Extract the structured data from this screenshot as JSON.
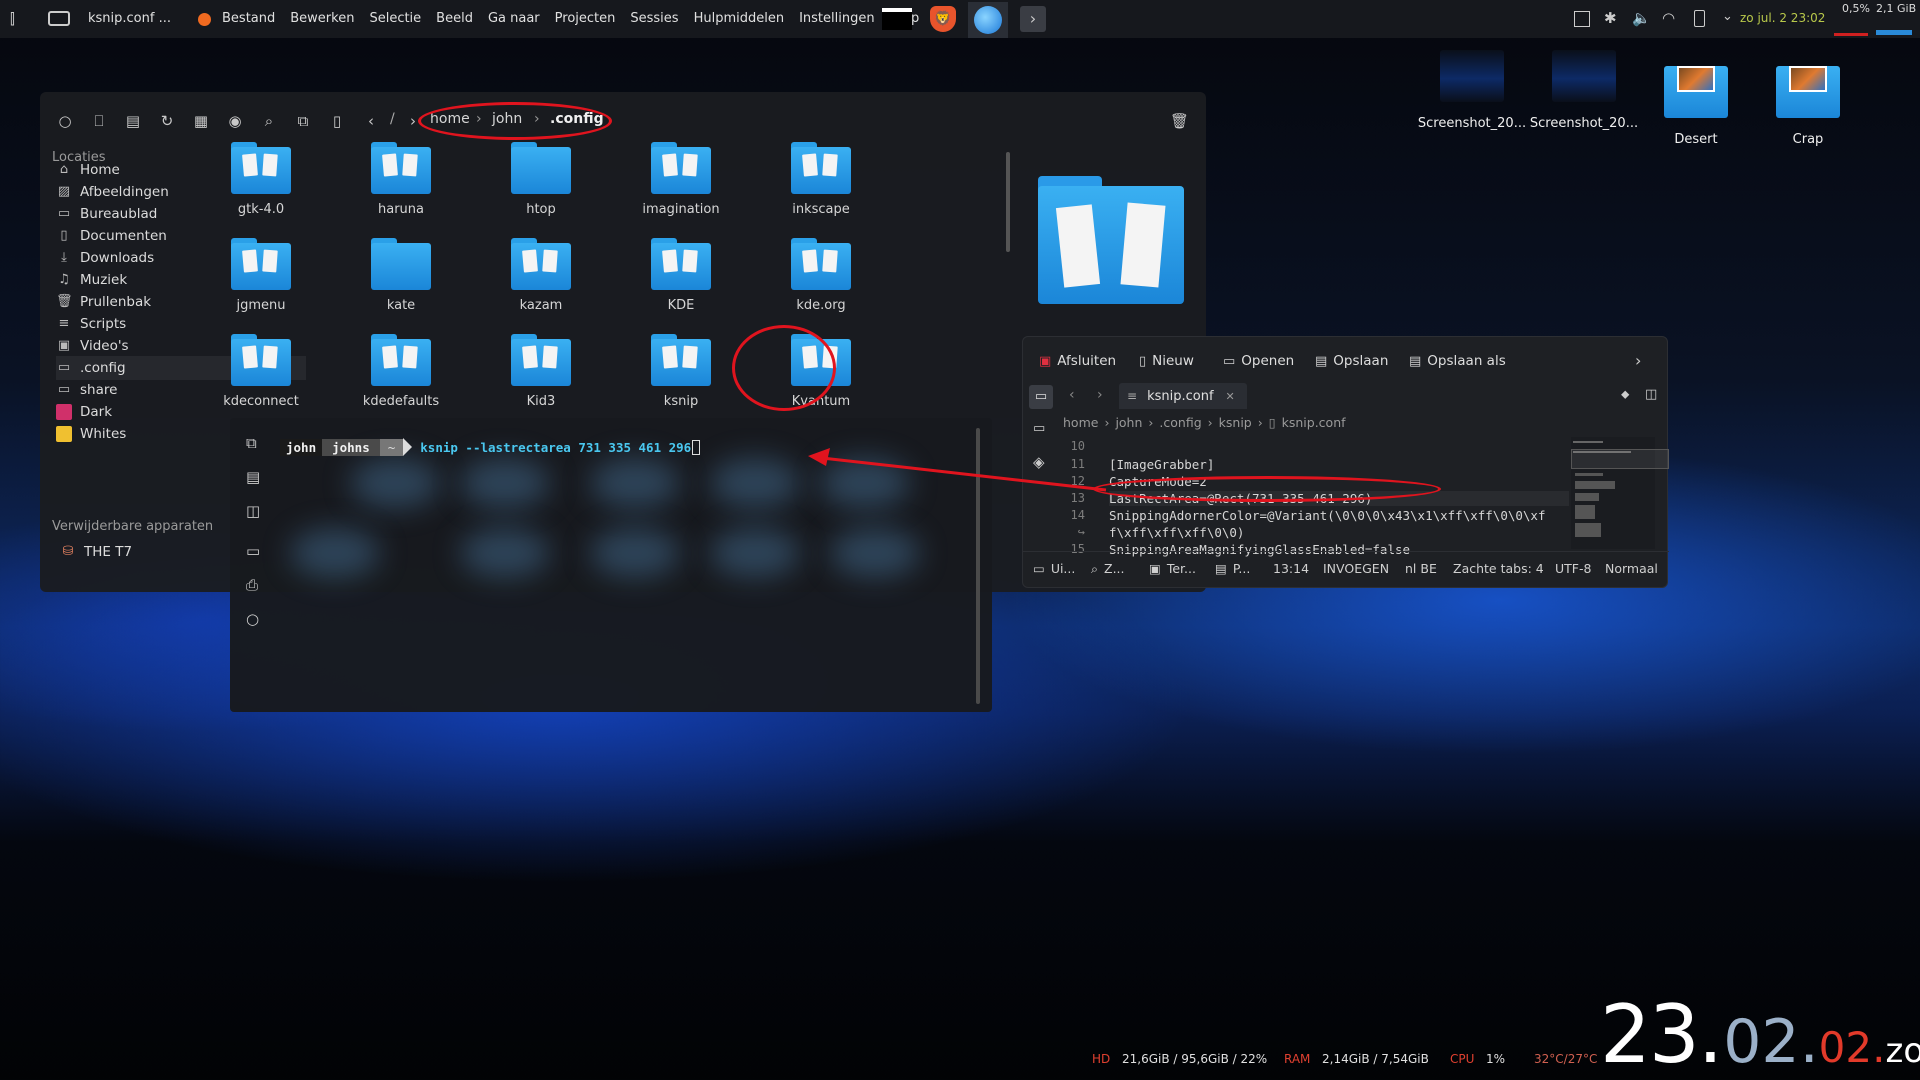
{
  "panel": {
    "window_title": "ksnip.conf ...",
    "menu": [
      "Bestand",
      "Bewerken",
      "Selectie",
      "Beeld",
      "Ga naar",
      "Projecten",
      "Sessies",
      "Hulpmiddelen",
      "Instellingen",
      "Help"
    ],
    "tray_date": "zo jul. 2 23:02",
    "cpu_percent": "0,5%",
    "mem_used": "2,1 GiB"
  },
  "file_manager": {
    "breadcrumb": [
      "home",
      "john",
      ".config"
    ],
    "breadcrumb_root": "/",
    "places_heading": "Locaties",
    "places": [
      {
        "label": "Home",
        "icon": "home-icon"
      },
      {
        "label": "Afbeeldingen",
        "icon": "image-icon"
      },
      {
        "label": "Bureaublad",
        "icon": "desktop-icon"
      },
      {
        "label": "Documenten",
        "icon": "document-icon"
      },
      {
        "label": "Downloads",
        "icon": "download-icon"
      },
      {
        "label": "Muziek",
        "icon": "music-icon"
      },
      {
        "label": "Prullenbak",
        "icon": "trash-icon"
      },
      {
        "label": "Scripts",
        "icon": "list-icon"
      },
      {
        "label": "Video's",
        "icon": "video-icon"
      },
      {
        "label": ".config",
        "icon": "folder-icon"
      },
      {
        "label": "share",
        "icon": "folder-icon"
      },
      {
        "label": "Dark",
        "icon": "folder-icon"
      },
      {
        "label": "Whites",
        "icon": "folder-icon"
      }
    ],
    "devices_heading": "Verwijderbare apparaten",
    "devices": [
      {
        "label": "THE T7",
        "icon": "usb-drive-icon"
      }
    ],
    "folders": [
      {
        "name": "gtk-4.0",
        "papers": true
      },
      {
        "name": "haruna",
        "papers": true
      },
      {
        "name": "htop",
        "papers": false
      },
      {
        "name": "imagination",
        "papers": true
      },
      {
        "name": "inkscape",
        "papers": true
      },
      {
        "name": "jgmenu",
        "papers": true
      },
      {
        "name": "kate",
        "papers": false
      },
      {
        "name": "kazam",
        "papers": true
      },
      {
        "name": "KDE",
        "papers": true
      },
      {
        "name": "kde.org",
        "papers": true
      },
      {
        "name": "kdeconnect",
        "papers": true
      },
      {
        "name": "kdedefaults",
        "papers": true
      },
      {
        "name": "Kid3",
        "papers": true
      },
      {
        "name": "ksnip",
        "papers": true
      },
      {
        "name": "Kvantum",
        "papers": true
      }
    ]
  },
  "terminal": {
    "user": "john",
    "host": "johns",
    "dir": "~",
    "command": "ksnip --lastrectarea 731 335 461 296"
  },
  "editor": {
    "toolbar": [
      "Afsluiten",
      "Nieuw",
      "Openen",
      "Opslaan",
      "Opslaan als"
    ],
    "tab_label": "ksnip.conf",
    "path": [
      "home",
      "john",
      ".config",
      "ksnip",
      "ksnip.conf"
    ],
    "lines": [
      {
        "n": "10",
        "text": ""
      },
      {
        "n": "11",
        "text": "[ImageGrabber]"
      },
      {
        "n": "12",
        "text": "CaptureMode=2"
      },
      {
        "n": "13",
        "text": "LastRectArea=@Rect(731 335 461 296)"
      },
      {
        "n": "14",
        "text": "SnippingAdornerColor=@Variant(\\0\\0\\0\\x43\\x1\\xff\\xff\\0\\0\\xf"
      },
      {
        "n": "↪",
        "text": "f\\xff\\xff\\xff\\0\\0)"
      },
      {
        "n": "15",
        "text": "SnippingAreaMagnifyingGlassEnabled=false"
      }
    ],
    "status": {
      "ui": "Ui...",
      "zoom": "Z...",
      "term": "Ter...",
      "proj": "P...",
      "cursor": "13:14",
      "mode": "INVOEGEN",
      "lang": "nl BE",
      "tabs": "Zachte tabs: 4",
      "encoding": "UTF-8",
      "view_mode": "Normaal"
    }
  },
  "desktop": {
    "icons": [
      {
        "label": "Screenshot_20...",
        "kind": "screenshot"
      },
      {
        "label": "Screenshot_20...",
        "kind": "screenshot"
      },
      {
        "label": "Desert",
        "kind": "folder"
      },
      {
        "label": "Crap",
        "kind": "folder"
      }
    ]
  },
  "stats": {
    "hd_label": "HD",
    "hd_value": "21,6GiB / 95,6GiB / 22%",
    "ram_label": "RAM",
    "ram_value": "2,14GiB / 7,54GiB",
    "cpu_label": "CPU",
    "cpu_value": "1%",
    "temp": "32°C/27°C"
  },
  "clock": {
    "hour": "23",
    "min": "02",
    "sec": "02",
    "day": "zo"
  },
  "colors": {
    "accent_folder": "#2a9ae8",
    "annotation_red": "#e0141e",
    "prompt_user_bg": "#1a1a1a",
    "prompt_host_bg": "#4a4a4a"
  }
}
